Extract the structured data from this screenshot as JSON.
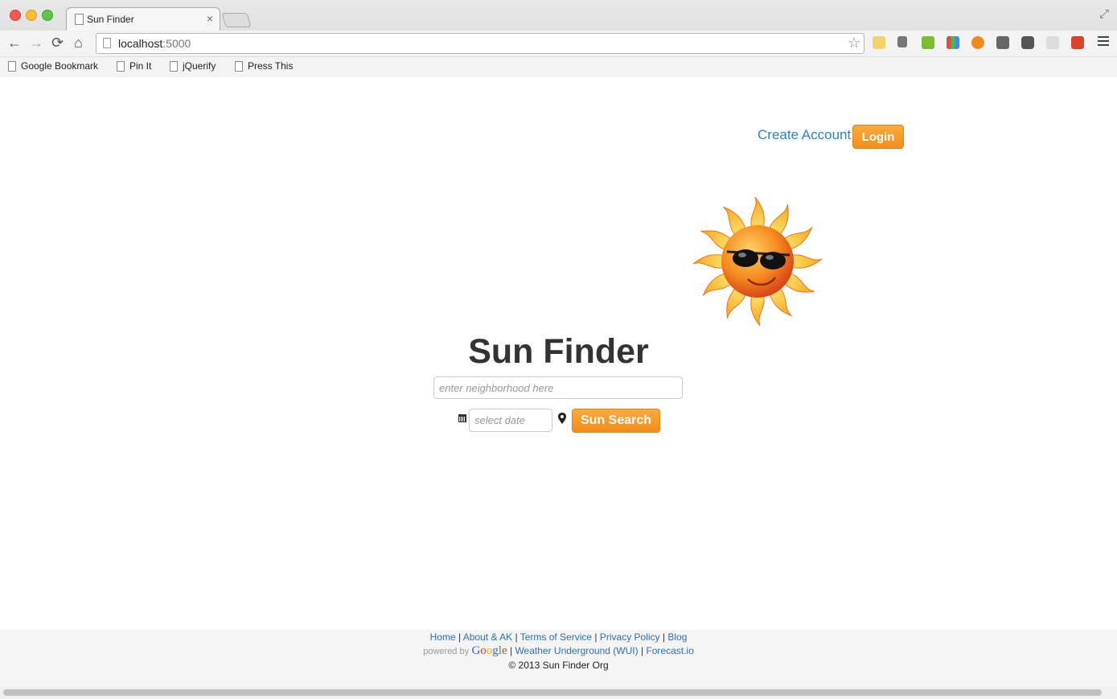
{
  "browser": {
    "tab_title": "Sun Finder",
    "tab_close": "×",
    "url_host": "localhost",
    "url_port": ":5000",
    "bookmarks": [
      "Google Bookmark",
      "Pin It",
      "jQuerify",
      "Press This"
    ]
  },
  "header": {
    "create_account": "Create Account",
    "login": "Login"
  },
  "main": {
    "title": "Sun Finder",
    "neighborhood_placeholder": "enter neighborhood here",
    "date_placeholder": "select date",
    "search_label": "Sun Search"
  },
  "footer": {
    "links": [
      "Home",
      "About & AK",
      "Terms of Service",
      "Privacy Policy",
      "Blog"
    ],
    "powered_by": "powered by",
    "google": "Google",
    "weather_underground": "Weather Underground (WUI)",
    "forecast": "Forecast.io",
    "copyright": "© 2013 Sun Finder Org"
  },
  "colors": {
    "accent_orange": "#f7941d",
    "link_blue": "#2b82c9"
  }
}
